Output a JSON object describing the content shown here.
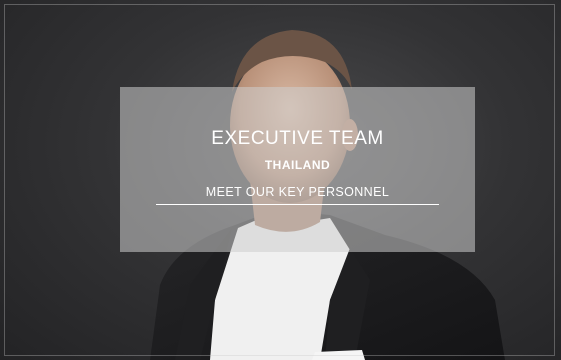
{
  "hero": {
    "title": "EXECUTIVE TEAM",
    "subtitle": "THAILAND",
    "link_label": "MEET OUR KEY PERSONNEL",
    "photo_icon": "portrait-photo-icon"
  },
  "colors": {
    "background": "#2f2f31",
    "overlay": "#cdcdcd",
    "text": "#ffffff",
    "suit": "#1b1b1d",
    "shirt": "#f2f2f2"
  }
}
